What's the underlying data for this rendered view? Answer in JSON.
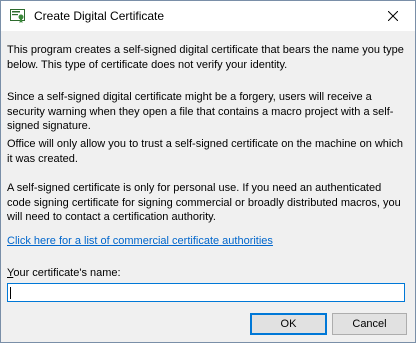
{
  "window": {
    "title": "Create Digital Certificate",
    "close_icon": "close-icon",
    "app_icon": "certificate-icon"
  },
  "content": {
    "paragraphs": [
      "This program creates a self-signed digital certificate that bears the name you type below. This type of certificate does not verify your identity.",
      "Since a self-signed digital certificate might be a forgery, users will receive a security warning when they open a file that contains a macro project with a self-signed signature.",
      "Office will only allow you to trust a self-signed certificate on the machine on which it was created.",
      "A self-signed certificate is only for personal use. If you need an authenticated code signing certificate for signing commercial or broadly distributed macros, you will need to contact a certification authority."
    ],
    "link_text": "Click here for a list of commercial certificate authorities",
    "name_label_mnemonic": "Y",
    "name_label_rest": "our certificate's name:",
    "name_value": ""
  },
  "buttons": {
    "ok_label": "OK",
    "cancel_label": "Cancel"
  },
  "colors": {
    "link": "#0066cc",
    "focus": "#0078d7",
    "dialog_bg": "#f0f0f0"
  }
}
